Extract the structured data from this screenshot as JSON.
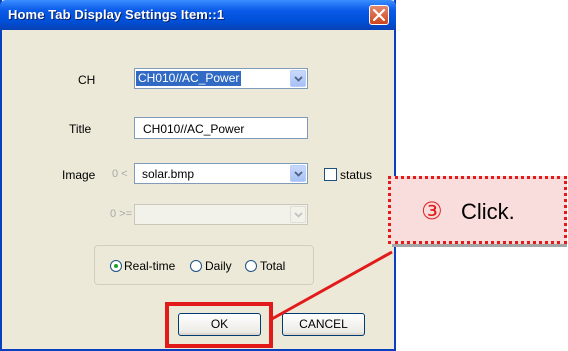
{
  "window": {
    "title": "Home Tab Display Settings Item::1"
  },
  "form": {
    "ch_label": "CH",
    "ch_value": "CH010//AC_Power",
    "title_label": "Title",
    "title_value": "CH010//AC_Power",
    "image_label": "Image",
    "image_cond": "0 <",
    "image_value": "solar.bmp",
    "status_label": "status",
    "status_checked": false,
    "image2_cond": "0 >="
  },
  "mode": {
    "options": [
      "Real-time",
      "Daily",
      "Total"
    ],
    "selected": "Real-time"
  },
  "buttons": {
    "ok": "OK",
    "cancel": "CANCEL"
  },
  "annotation": {
    "step": "③",
    "text": "Click."
  },
  "colors": {
    "highlight": "#e31a1a",
    "title_bar": "#0a5ae8",
    "dialog_bg": "#ece9d8"
  }
}
